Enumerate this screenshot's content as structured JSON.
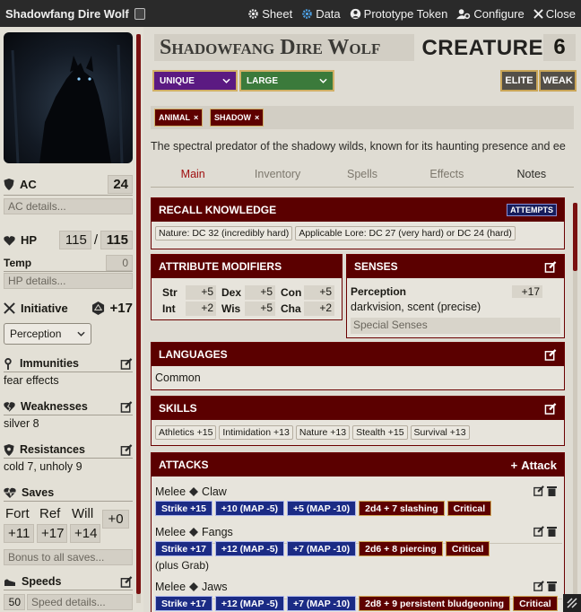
{
  "window": {
    "title": "Shadowfang Dire Wolf",
    "buttons": [
      {
        "label": "Sheet",
        "icon": "gear-icon"
      },
      {
        "label": "Data",
        "icon": "data-gear-icon"
      },
      {
        "label": "Prototype Token",
        "icon": "user-circle-icon"
      },
      {
        "label": "Configure",
        "icon": "user-cog-icon"
      },
      {
        "label": "Close",
        "icon": "close-icon"
      }
    ]
  },
  "sidebar": {
    "ac": {
      "label": "AC",
      "value": "24",
      "details_placeholder": "AC details..."
    },
    "hp": {
      "label": "HP",
      "value": "115",
      "separator": "/",
      "max": "115"
    },
    "temp": {
      "label": "Temp",
      "value": "0",
      "details_placeholder": "HP details..."
    },
    "initiative": {
      "label": "Initiative",
      "value": "+17",
      "select": "Perception"
    },
    "immunities": {
      "label": "Immunities",
      "value": "fear effects"
    },
    "weaknesses": {
      "label": "Weaknesses",
      "value": "silver 8"
    },
    "resistances": {
      "label": "Resistances",
      "value": "cold 7, unholy 9"
    },
    "saves": {
      "label": "Saves",
      "headers": [
        "Fort",
        "Ref",
        "Will"
      ],
      "values": [
        "+11",
        "+17",
        "+14"
      ],
      "extra": "+0",
      "placeholder": "Bonus to all saves..."
    },
    "speeds": {
      "label": "Speeds",
      "value": "50",
      "placeholder": "Speed details..."
    }
  },
  "header": {
    "name": "Shadowfang Dire Wolf",
    "type_label": "CREATURE",
    "level": "6",
    "rarity": "UNIQUE",
    "size": "LARGE",
    "elite": "ELITE",
    "weak": "WEAK",
    "traits": [
      "ANIMAL",
      "SHADOW"
    ],
    "remove_glyph": "×",
    "description": "The spectral predator of the shadowy wilds, known for its haunting presence and ee"
  },
  "tabs": [
    "Main",
    "Inventory",
    "Spells",
    "Effects",
    "Notes"
  ],
  "recall": {
    "title": "RECALL KNOWLEDGE",
    "attempts": "ATTEMPTS",
    "items": [
      "Nature: DC 32 (incredibly hard)",
      "Applicable Lore: DC 27 (very hard) or DC 24 (hard)"
    ]
  },
  "attributes": {
    "title": "ATTRIBUTE MODIFIERS",
    "mods": [
      {
        "name": "Str",
        "value": "+5"
      },
      {
        "name": "Dex",
        "value": "+5"
      },
      {
        "name": "Con",
        "value": "+5"
      },
      {
        "name": "Int",
        "value": "+2"
      },
      {
        "name": "Wis",
        "value": "+5"
      },
      {
        "name": "Cha",
        "value": "+2"
      }
    ]
  },
  "senses": {
    "title": "SENSES",
    "perception_label": "Perception",
    "perception_value": "+17",
    "details": "darkvision, scent (precise)",
    "placeholder": "Special Senses"
  },
  "languages": {
    "title": "LANGUAGES",
    "value": "Common"
  },
  "skills": {
    "title": "SKILLS",
    "items": [
      "Athletics +15",
      "Intimidation +13",
      "Nature +13",
      "Stealth +15",
      "Survival +13"
    ]
  },
  "attacks": {
    "title": "ATTACKS",
    "add_label": "Attack",
    "add_glyph": "+",
    "list": [
      {
        "type": "Melee",
        "name": "Claw",
        "strike": "Strike +15",
        "map1": "+10 (MAP -5)",
        "map2": "+5 (MAP -10)",
        "damage": "2d4 + 7 slashing",
        "critical": "Critical",
        "note": ""
      },
      {
        "type": "Melee",
        "name": "Fangs",
        "strike": "Strike +17",
        "map1": "+12 (MAP -5)",
        "map2": "+7 (MAP -10)",
        "damage": "2d6 + 8 piercing",
        "critical": "Critical",
        "note": "(plus Grab)"
      },
      {
        "type": "Melee",
        "name": "Jaws",
        "strike": "Strike +17",
        "map1": "+12 (MAP -5)",
        "map2": "+7 (MAP -10)",
        "damage": "2d8 + 9 persistent bludgeoning",
        "critical": "Critical",
        "note": ""
      }
    ]
  },
  "colors": {
    "accent": "#5b0000",
    "rarity": "#5b1a82",
    "size": "#3b7a3b",
    "strike": "#1b2b85"
  }
}
